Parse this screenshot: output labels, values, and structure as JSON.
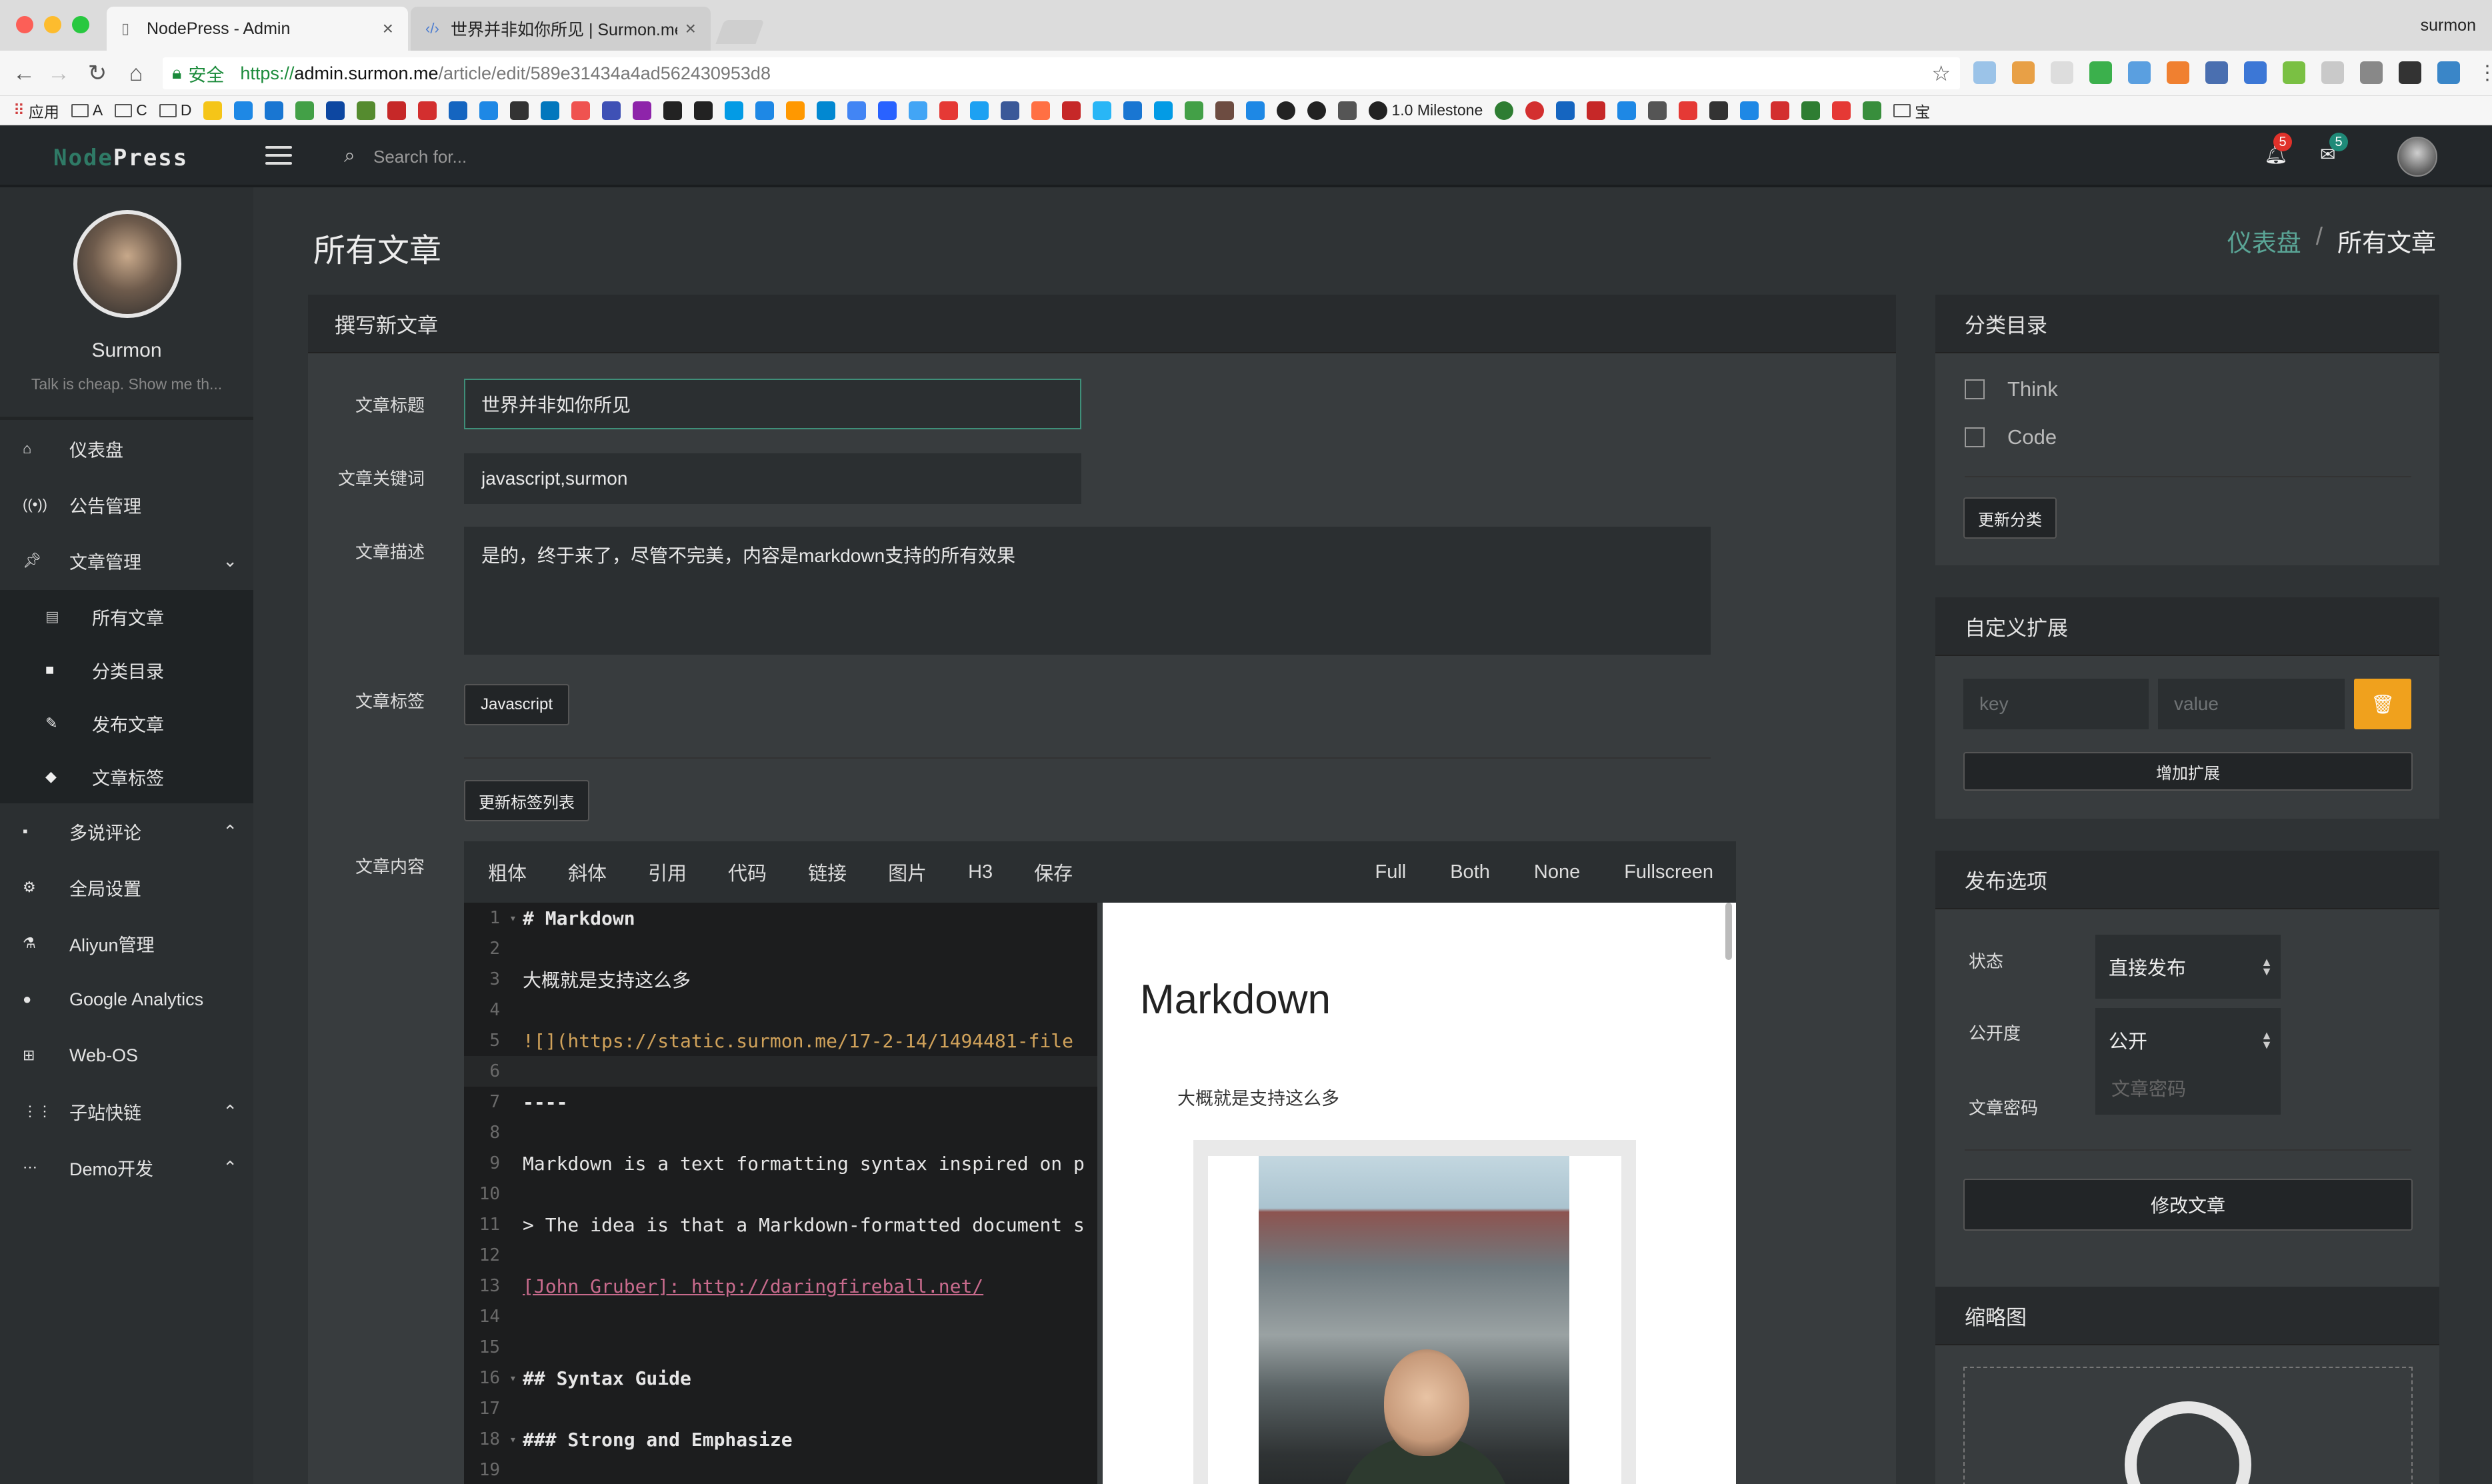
{
  "browser": {
    "tabs": [
      {
        "title": "NodePress - Admin",
        "active": true
      },
      {
        "title": "世界并非如你所见 | Surmon.me",
        "active": false
      }
    ],
    "profile_name": "surmon",
    "address": {
      "security_label": "安全",
      "url_protocol": "https://",
      "url_host": "admin.surmon.me",
      "url_path": "/article/edit/589e31434a4ad562430953d8"
    },
    "bookmarks": {
      "apps_label": "应用",
      "folders": [
        "A",
        "C",
        "D"
      ],
      "milestone_label": "1.0 Milestone",
      "last_folder": "宝"
    }
  },
  "topbar": {
    "logo_part1": "Node",
    "logo_part2": "Press",
    "search_placeholder": "Search for...",
    "notifications_count": "5",
    "messages_count": "5"
  },
  "sidebar": {
    "profile_name": "Surmon",
    "slogan": "Talk is cheap. Show me th...",
    "items": [
      {
        "label": "仪表盘",
        "icon": "home-icon"
      },
      {
        "label": "公告管理",
        "icon": "broadcast-icon"
      },
      {
        "label": "文章管理",
        "icon": "pin-icon"
      },
      {
        "label": "多说评论",
        "icon": "comment-icon"
      },
      {
        "label": "全局设置",
        "icon": "gear-icon"
      },
      {
        "label": "Aliyun管理",
        "icon": "flask-icon"
      },
      {
        "label": "Google Analytics",
        "icon": "pie-chart-icon"
      },
      {
        "label": "Web-OS",
        "icon": "windows-icon"
      },
      {
        "label": "子站快链",
        "icon": "grid-icon"
      },
      {
        "label": "Demo开发",
        "icon": "ellipsis-icon"
      }
    ],
    "submenu": [
      {
        "label": "所有文章",
        "icon": "list-icon"
      },
      {
        "label": "分类目录",
        "icon": "folder-icon"
      },
      {
        "label": "发布文章",
        "icon": "edit-icon"
      },
      {
        "label": "文章标签",
        "icon": "tag-icon"
      }
    ]
  },
  "header": {
    "title": "所有文章",
    "breadcrumb": {
      "link": "仪表盘",
      "separator": "/",
      "current": "所有文章"
    }
  },
  "editor": {
    "panel_title": "撰写新文章",
    "labels": {
      "title": "文章标题",
      "keywords": "文章关键词",
      "description": "文章描述",
      "tags": "文章标签",
      "content": "文章内容"
    },
    "title_value": "世界并非如你所见",
    "keywords_value": "javascript,surmon",
    "description_value": "是的，终于来了，尽管不完美，内容是markdown支持的所有效果",
    "tag_button": "Javascript",
    "update_tags_button": "更新标签列表",
    "toolbar_left": [
      "粗体",
      "斜体",
      "引用",
      "代码",
      "链接",
      "图片",
      "H3",
      "保存"
    ],
    "toolbar_right": [
      "Full",
      "Both",
      "None",
      "Fullscreen"
    ],
    "code_lines": [
      {
        "n": "1",
        "fold": true,
        "text": "# Markdown",
        "style": "b"
      },
      {
        "n": "2",
        "text": ""
      },
      {
        "n": "3",
        "text": "大概就是支持这么多"
      },
      {
        "n": "4",
        "text": ""
      },
      {
        "n": "5",
        "text": "![](https://static.surmon.me/17-2-14/1494481-file",
        "style": "link"
      },
      {
        "n": "6",
        "text": "",
        "current": true
      },
      {
        "n": "7",
        "text": "----",
        "style": "b"
      },
      {
        "n": "8",
        "text": ""
      },
      {
        "n": "9",
        "text": "Markdown is a text formatting syntax inspired on p"
      },
      {
        "n": "10",
        "text": ""
      },
      {
        "n": "11",
        "text": "> The idea is that a Markdown-formatted document s"
      },
      {
        "n": "12",
        "text": ""
      },
      {
        "n": "13",
        "text": "[John Gruber]: http://daringfireball.net/",
        "style": "ref"
      },
      {
        "n": "14",
        "text": ""
      },
      {
        "n": "15",
        "text": ""
      },
      {
        "n": "16",
        "fold": true,
        "text": "## Syntax Guide",
        "style": "b"
      },
      {
        "n": "17",
        "text": ""
      },
      {
        "n": "18",
        "fold": true,
        "text": "### Strong and Emphasize",
        "style": "b"
      },
      {
        "n": "19",
        "text": ""
      }
    ],
    "preview": {
      "heading": "Markdown",
      "paragraph": "大概就是支持这么多"
    }
  },
  "category_panel": {
    "title": "分类目录",
    "options": [
      "Think",
      "Code"
    ],
    "update_button": "更新分类"
  },
  "extension_panel": {
    "title": "自定义扩展",
    "key_placeholder": "key",
    "value_placeholder": "value",
    "add_button": "增加扩展"
  },
  "publish_panel": {
    "title": "发布选项",
    "status_label": "状态",
    "status_value": "直接发布",
    "visibility_label": "公开度",
    "visibility_value": "公开",
    "password_label": "文章密码",
    "password_placeholder": "文章密码",
    "submit_button": "修改文章"
  },
  "thumb_panel": {
    "title": "缩略图"
  },
  "colors": {
    "accent": "#3f8f79",
    "warning": "#f0a11d",
    "badge_red": "#e0312a",
    "badge_teal": "#1f8a78"
  }
}
